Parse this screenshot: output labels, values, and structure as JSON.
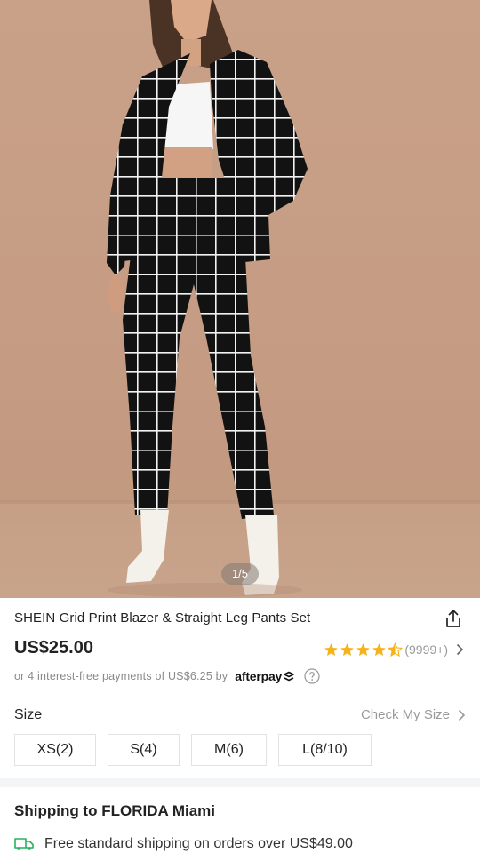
{
  "gallery": {
    "pager": "1/5"
  },
  "product": {
    "title": "SHEIN Grid Print Blazer & Straight Leg Pants Set",
    "price": "US$25.00",
    "rating": {
      "stars": 4.5,
      "count": "(9999+)"
    },
    "afterpay": {
      "text": "or 4 interest-free payments of US$6.25 by",
      "brand": "afterpay"
    }
  },
  "size": {
    "label": "Size",
    "check_label": "Check My Size",
    "options": [
      "XS(2)",
      "S(4)",
      "M(6)",
      "L(8/10)"
    ]
  },
  "shipping": {
    "title": "Shipping to FLORIDA Miami",
    "line": "Free standard shipping on orders over US$49.00"
  },
  "colors": {
    "star": "#f7b21b",
    "text": "#222222",
    "muted": "#999999",
    "truck": "#25b35a"
  }
}
